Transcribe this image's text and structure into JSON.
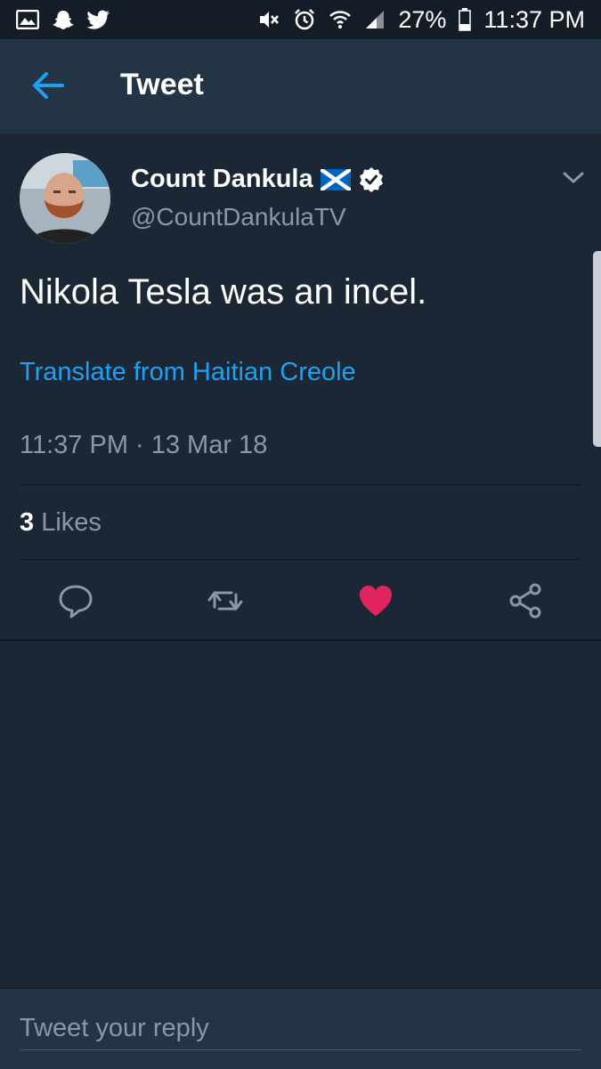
{
  "status_bar": {
    "battery": "27%",
    "time": "11:37 PM"
  },
  "app_bar": {
    "title": "Tweet"
  },
  "tweet": {
    "author_name": "Count Dankula",
    "author_handle": "@CountDankulaTV",
    "verified": true,
    "text": "Nikola Tesla was an incel.",
    "translate_label": "Translate from Haitian Creole",
    "timestamp": "11:37 PM · 13 Mar 18",
    "likes_count": "3",
    "likes_label": "Likes",
    "liked": true
  },
  "reply": {
    "placeholder": "Tweet your reply"
  },
  "colors": {
    "background": "#1c2735",
    "app_bar": "#243447",
    "link": "#1da1f2",
    "muted": "#8899a6",
    "like": "#e0245e"
  },
  "icons": [
    "image-icon",
    "snapchat-icon",
    "twitter-icon",
    "mute-icon",
    "alarm-icon",
    "wifi-icon",
    "signal-icon",
    "battery-icon",
    "back-arrow-icon",
    "flag-icon",
    "verified-badge-icon",
    "chevron-down-icon",
    "reply-icon",
    "retweet-icon",
    "heart-icon",
    "share-icon"
  ]
}
